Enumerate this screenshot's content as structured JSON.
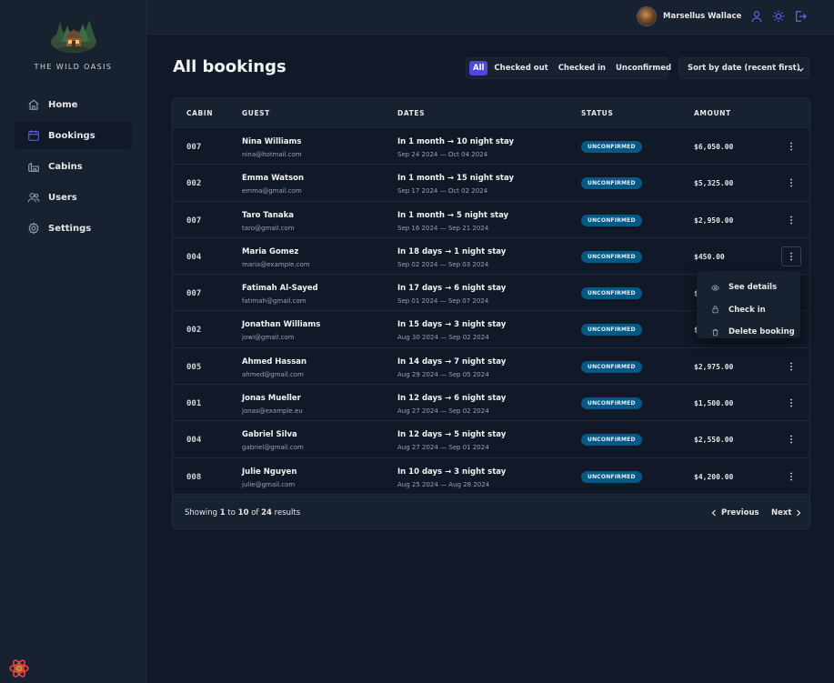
{
  "brand": {
    "name": "THE WILD OASIS"
  },
  "sidebar": {
    "items": [
      {
        "label": "Home",
        "icon": "home-icon"
      },
      {
        "label": "Bookings",
        "icon": "calendar-icon",
        "active": true
      },
      {
        "label": "Cabins",
        "icon": "cabins-icon"
      },
      {
        "label": "Users",
        "icon": "users-icon"
      },
      {
        "label": "Settings",
        "icon": "settings-icon"
      }
    ]
  },
  "header": {
    "username": "Marsellus Wallace",
    "icons": [
      "user-icon",
      "sun-icon",
      "logout-icon"
    ]
  },
  "page": {
    "title": "All bookings"
  },
  "filter": {
    "options": [
      "All",
      "Checked out",
      "Checked in",
      "Unconfirmed"
    ],
    "active": "All"
  },
  "sort": {
    "selected": "Sort by date (recent first)"
  },
  "table": {
    "headers": {
      "cabin": "CABIN",
      "guest": "GUEST",
      "dates": "DATES",
      "status": "STATUS",
      "amount": "AMOUNT"
    },
    "rows": [
      {
        "cabin": "007",
        "guest": "Nina Williams",
        "email": "nina@hotmail.com",
        "stay": "In 1 month → 10 night stay",
        "dates": "Sep 24 2024 — Oct 04 2024",
        "status": "UNCONFIRMED",
        "amount": "$6,050.00"
      },
      {
        "cabin": "002",
        "guest": "Emma Watson",
        "email": "emma@gmail.com",
        "stay": "In 1 month → 15 night stay",
        "dates": "Sep 17 2024 — Oct 02 2024",
        "status": "UNCONFIRMED",
        "amount": "$5,325.00"
      },
      {
        "cabin": "007",
        "guest": "Taro Tanaka",
        "email": "taro@gmail.com",
        "stay": "In 1 month → 5 night stay",
        "dates": "Sep 16 2024 — Sep 21 2024",
        "status": "UNCONFIRMED",
        "amount": "$2,950.00"
      },
      {
        "cabin": "004",
        "guest": "Maria Gomez",
        "email": "maria@example.com",
        "stay": "In 18 days → 1 night stay",
        "dates": "Sep 02 2024 — Sep 03 2024",
        "status": "UNCONFIRMED",
        "amount": "$450.00"
      },
      {
        "cabin": "007",
        "guest": "Fatimah Al-Sayed",
        "email": "fatimah@gmail.com",
        "stay": "In 17 days → 6 night stay",
        "dates": "Sep 01 2024 — Sep 07 2024",
        "status": "UNCONFIRMED",
        "amount": "$"
      },
      {
        "cabin": "002",
        "guest": "Jonathan Williams",
        "email": "jowi@gmail.com",
        "stay": "In 15 days → 3 night stay",
        "dates": "Aug 30 2024 — Sep 02 2024",
        "status": "UNCONFIRMED",
        "amount": "$"
      },
      {
        "cabin": "005",
        "guest": "Ahmed Hassan",
        "email": "ahmed@gmail.com",
        "stay": "In 14 days → 7 night stay",
        "dates": "Aug 29 2024 — Sep 05 2024",
        "status": "UNCONFIRMED",
        "amount": "$2,975.00"
      },
      {
        "cabin": "001",
        "guest": "Jonas Mueller",
        "email": "jonas@example.eu",
        "stay": "In 12 days → 6 night stay",
        "dates": "Aug 27 2024 — Sep 02 2024",
        "status": "UNCONFIRMED",
        "amount": "$1,500.00"
      },
      {
        "cabin": "004",
        "guest": "Gabriel Silva",
        "email": "gabriel@gmail.com",
        "stay": "In 12 days → 5 night stay",
        "dates": "Aug 27 2024 — Sep 01 2024",
        "status": "UNCONFIRMED",
        "amount": "$2,550.00"
      },
      {
        "cabin": "008",
        "guest": "Julie Nguyen",
        "email": "julie@gmail.com",
        "stay": "In 10 days → 3 night stay",
        "dates": "Aug 25 2024 — Aug 28 2024",
        "status": "UNCONFIRMED",
        "amount": "$4,200.00"
      }
    ]
  },
  "row_menu": {
    "open_row": 3,
    "items": [
      {
        "label": "See details",
        "icon": "eye-icon"
      },
      {
        "label": "Check in",
        "icon": "check-in-icon"
      },
      {
        "label": "Delete booking",
        "icon": "trash-icon"
      }
    ]
  },
  "pagination": {
    "prefix": "Showing",
    "from": "1",
    "mid": "to",
    "to": "10",
    "of": "of",
    "total": "24",
    "suffix": "results",
    "previous": "Previous",
    "next": "Next"
  },
  "colors": {
    "accent": "#4f46e5",
    "status_unconfirmed_bg": "#075985",
    "background": "#111827",
    "panel": "#18212f"
  }
}
